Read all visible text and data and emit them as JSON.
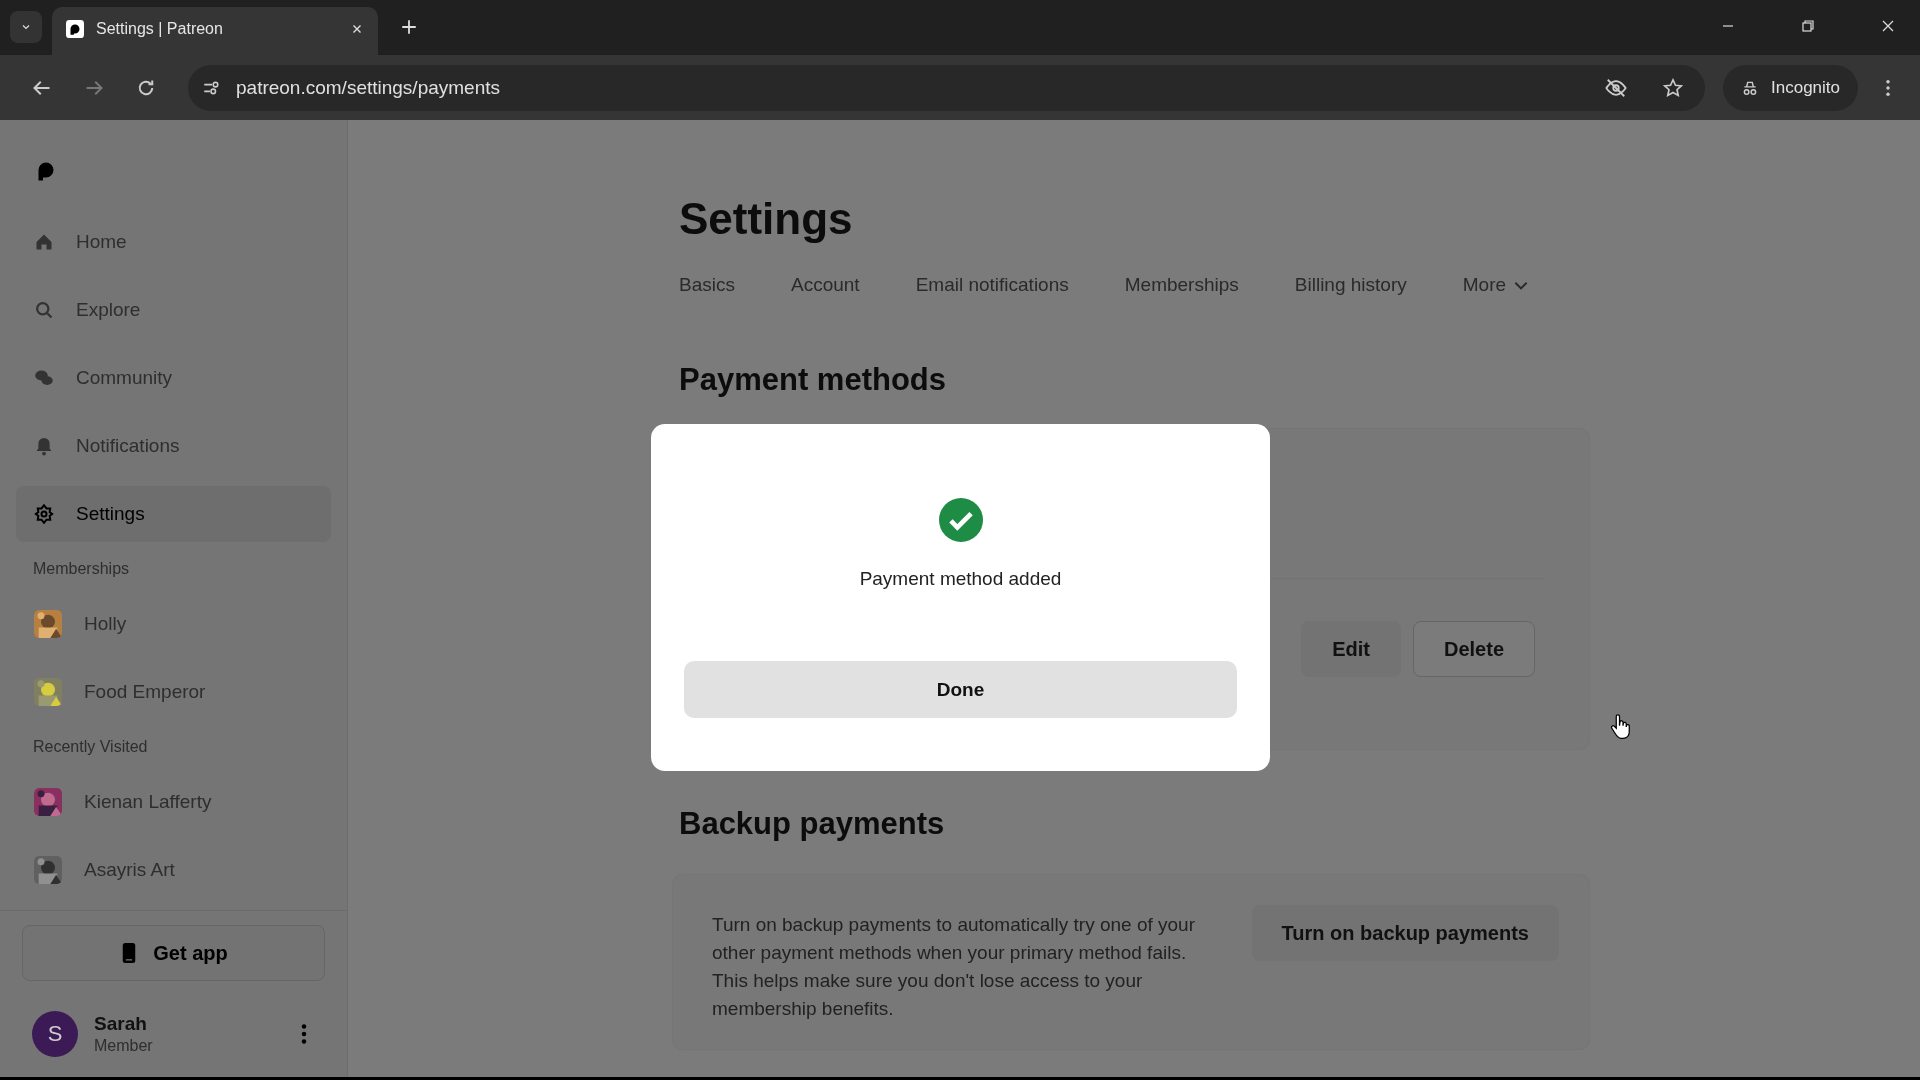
{
  "browser": {
    "tab_title": "Settings | Patreon",
    "url": "patreon.com/settings/payments",
    "profile": "Incognito"
  },
  "sidebar": {
    "nav": [
      {
        "label": "Home",
        "selected": false
      },
      {
        "label": "Explore",
        "selected": false
      },
      {
        "label": "Community",
        "selected": false
      },
      {
        "label": "Notifications",
        "selected": false
      },
      {
        "label": "Settings",
        "selected": true
      }
    ],
    "sections": [
      {
        "title": "Memberships",
        "items": [
          {
            "label": "Holly"
          },
          {
            "label": "Food Emperor"
          }
        ]
      },
      {
        "title": "Recently Visited",
        "items": [
          {
            "label": "Kienan Lafferty"
          },
          {
            "label": "Asayris Art"
          }
        ]
      }
    ],
    "get_app": "Get app",
    "user": {
      "initial": "S",
      "name": "Sarah",
      "role": "Member"
    }
  },
  "page": {
    "title": "Settings",
    "tabs": [
      {
        "label": "Basics",
        "selected": false
      },
      {
        "label": "Account",
        "selected": false
      },
      {
        "label": "Email notifications",
        "selected": false
      },
      {
        "label": "Memberships",
        "selected": false
      },
      {
        "label": "Billing history",
        "selected": false
      },
      {
        "label": "More",
        "selected": false,
        "kind": "dropdown"
      }
    ],
    "payment_methods": {
      "title": "Payment methods",
      "buttons": [
        "Edit",
        "Delete"
      ]
    },
    "backup": {
      "title": "Backup payments",
      "text": "Turn on backup payments to automatically try one of your other payment methods when your primary method fails. This helps make sure you don't lose access to your membership benefits.",
      "button": "Turn on backup payments"
    }
  },
  "dialog": {
    "message": "Payment method added",
    "button": "Done"
  }
}
